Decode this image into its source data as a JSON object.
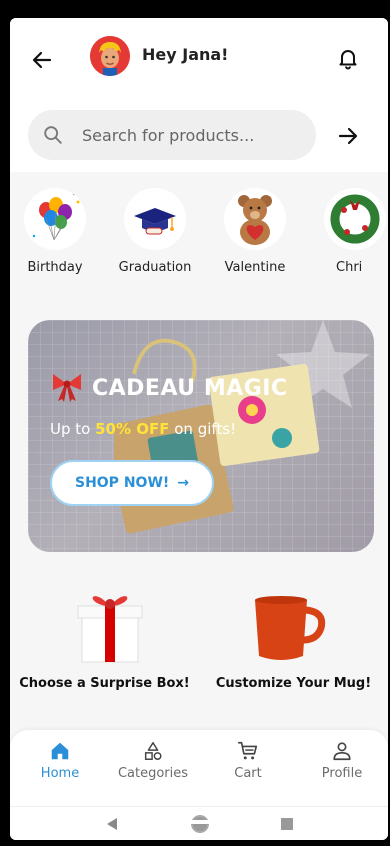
{
  "header": {
    "greeting": "Hey Jana!"
  },
  "search": {
    "placeholder": "Search for products..."
  },
  "categories": [
    {
      "label": "Birthday"
    },
    {
      "label": "Graduation"
    },
    {
      "label": "Valentine"
    },
    {
      "label": "Chri"
    }
  ],
  "banner": {
    "title": "CADEAU MAGIC",
    "sub_prefix": "Up to ",
    "sub_highlight": "50% OFF",
    "sub_suffix": " on gifts!",
    "button_label": "SHOP NOW!",
    "button_arrow": "→"
  },
  "promos": [
    {
      "label": "Choose a Surprise Box!"
    },
    {
      "label": "Customize Your Mug!"
    }
  ],
  "nav": [
    {
      "label": "Home",
      "icon": "home-icon",
      "active": true
    },
    {
      "label": "Categories",
      "icon": "shapes-icon",
      "active": false
    },
    {
      "label": "Cart",
      "icon": "cart-icon",
      "active": false
    },
    {
      "label": "Profile",
      "icon": "profile-icon",
      "active": false
    }
  ],
  "colors": {
    "accent": "#2a8fd6",
    "highlight": "#ffe23a"
  }
}
